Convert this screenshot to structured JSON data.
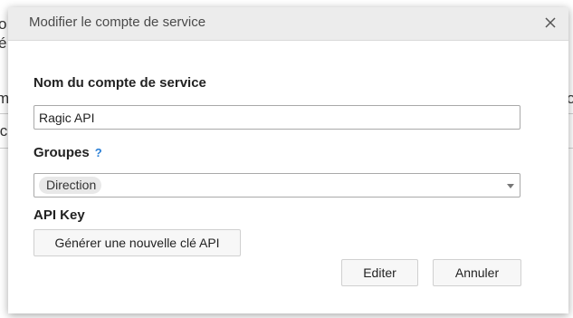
{
  "background": {
    "fragments": [
      "o",
      "é",
      "m",
      "ic",
      "o"
    ]
  },
  "dialog": {
    "title": "Modifier le compte de service",
    "close_icon": "close-icon",
    "fields": {
      "name_label": "Nom du compte de service",
      "name_value": "Ragic API",
      "groups_label": "Groupes",
      "groups_help": "?",
      "groups_selected": [
        "Direction"
      ],
      "api_key_label": "API Key",
      "generate_key_button": "Générer une nouvelle clé API"
    },
    "buttons": {
      "edit": "Editer",
      "cancel": "Annuler"
    }
  }
}
